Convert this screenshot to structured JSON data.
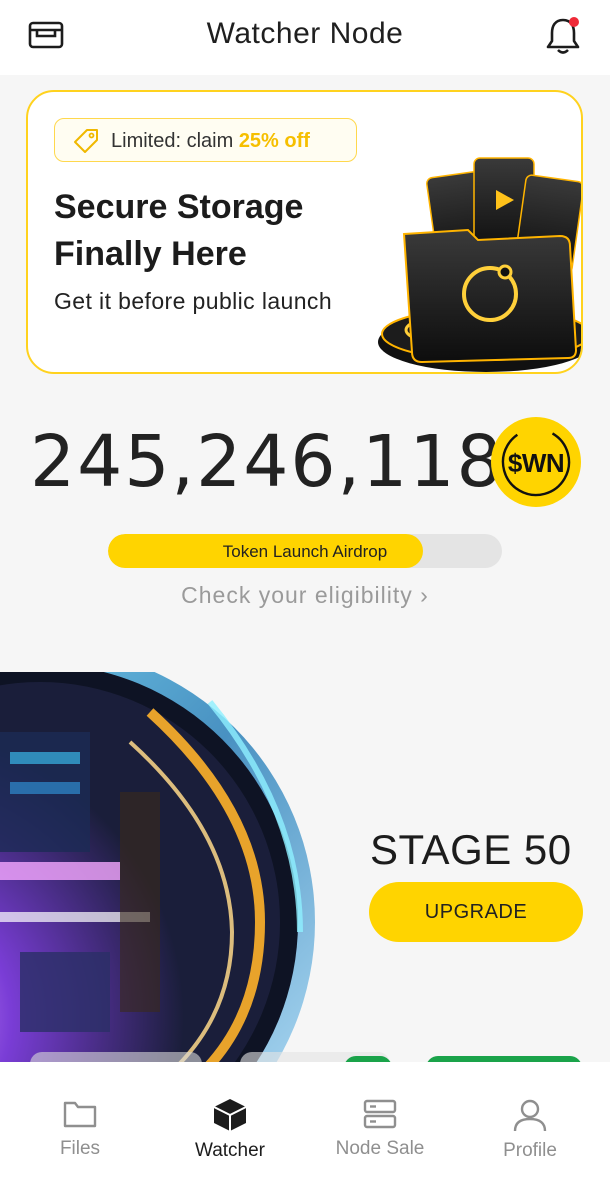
{
  "header": {
    "title": "Watcher Node",
    "left_icon": "wallet-icon",
    "right_icon": "bell-icon",
    "notification_dot_color": "#ef2a38"
  },
  "promo": {
    "tag_prefix": "Limited: claim ",
    "tag_highlight": "25% off",
    "tag_icon": "price-tag-icon",
    "headline": "Secure Storage Finally Here",
    "subtext": "Get it before public launch",
    "border_color": "#ffd21e"
  },
  "stats": {
    "token_count": "245,246,118",
    "token_symbol": "$WN"
  },
  "airdrop": {
    "label": "Token Launch Airdrop",
    "progress": 0.8,
    "link_text": "Check your eligibility",
    "link_chevron": "›"
  },
  "node": {
    "stage_label": "STAGE 50",
    "upgrade_label": "UPGRADE"
  },
  "tabs": [
    {
      "label": "Files",
      "icon": "folder-icon",
      "active": false
    },
    {
      "label": "Watcher",
      "icon": "cube-icon",
      "active": true
    },
    {
      "label": "Node Sale",
      "icon": "server-icon",
      "active": false
    },
    {
      "label": "Profile",
      "icon": "person-icon",
      "active": false
    }
  ],
  "colors": {
    "accent": "#ffd400",
    "background": "#f6f6f6",
    "muted_text": "#9a9a9a"
  }
}
